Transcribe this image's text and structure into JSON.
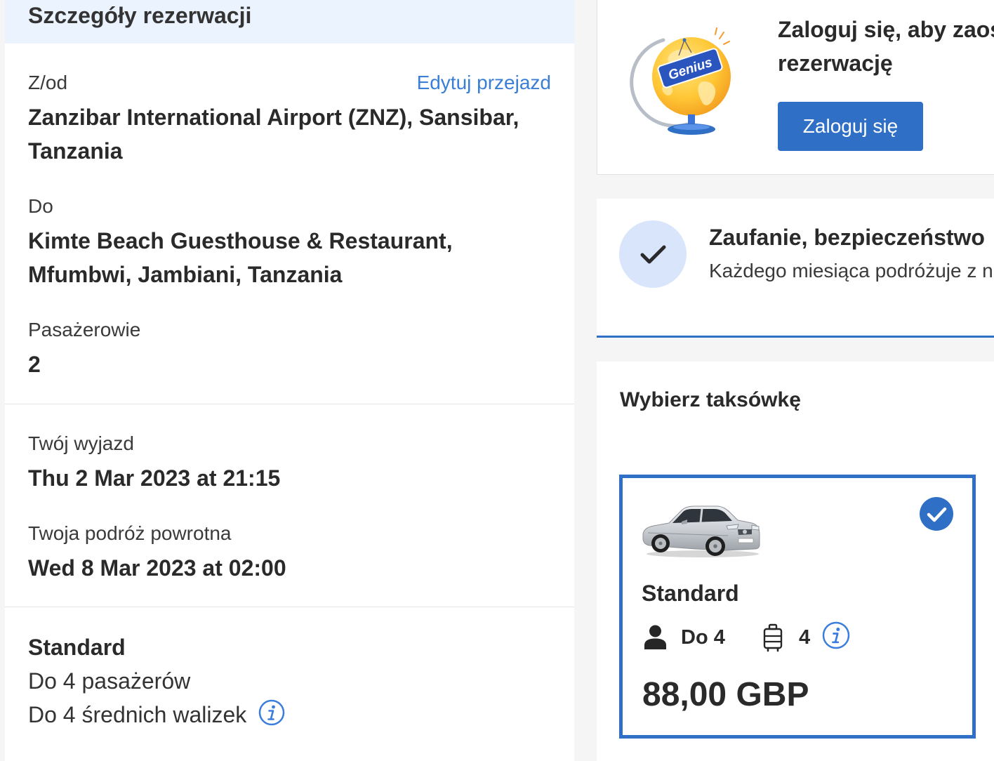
{
  "booking_details": {
    "title": "Szczegóły rezerwacji",
    "route": {
      "from_label": "Z/od",
      "edit_link": "Edytuj przejazd",
      "from_value": "Zanzibar International Airport (ZNZ), Sansibar, Tanzania",
      "to_label": "Do",
      "to_value": "Kimte Beach Guesthouse & Restaurant, Mfumbwi, Jambiani, Tanzania",
      "passengers_label": "Pasażerowie",
      "passengers_value": "2"
    },
    "dates": {
      "departure_label": "Twój wyjazd",
      "departure_value": "Thu 2 Mar 2023 at 21:15",
      "return_label": "Twoja podróż powrotna",
      "return_value": "Wed 8 Mar 2023 at 02:00"
    },
    "vehicle": {
      "name": "Standard",
      "passengers": "Do 4 pasażerów",
      "luggage": "Do 4 średnich walizek",
      "info_icon": "info-icon"
    }
  },
  "login_panel": {
    "illustration": "genius-globe-illustration",
    "badge_text": "Genius",
    "title_line1": "Zaloguj się, aby zaos",
    "title_line2": "rezerwację",
    "button_label": "Zaloguj się"
  },
  "trust_panel": {
    "icon": "checkmark-icon",
    "title": "Zaufanie, bezpieczeństwo",
    "subtitle": "Każdego miesiąca podróżuje z n"
  },
  "taxi_selection": {
    "title": "Wybierz taksówkę",
    "options": [
      {
        "image": "silver-sedan-image",
        "selected": true,
        "selected_icon": "check-circle-icon",
        "name": "Standard",
        "passenger_icon": "person-icon",
        "passengers": "Do 4",
        "luggage_icon": "luggage-icon",
        "luggage": "4",
        "info_icon": "info-icon",
        "price": "88,00 GBP"
      }
    ]
  },
  "colors": {
    "page_bg": "#f5f5f5",
    "header_bg": "#ebf3ff",
    "accent": "#2f6fc6",
    "link": "#3a7fd5",
    "check_circle_bg": "#d8e5fb",
    "text": "#2a2a2a"
  }
}
